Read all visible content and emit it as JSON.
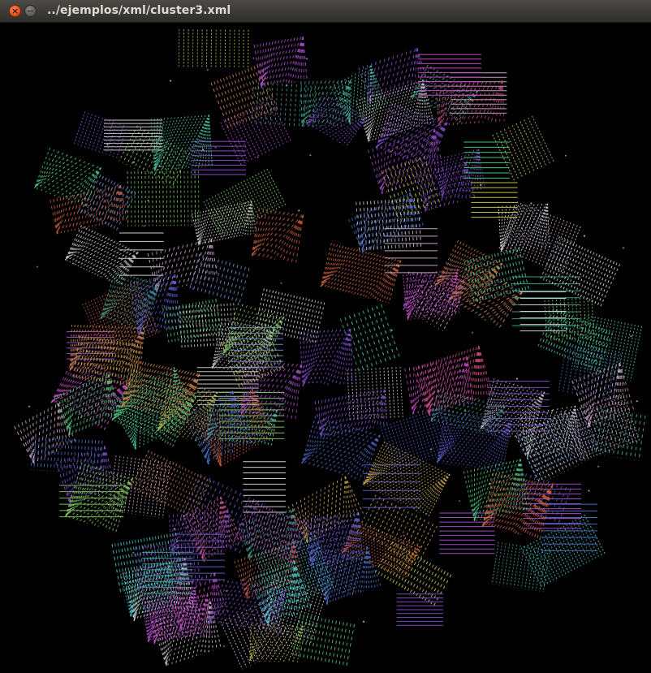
{
  "window": {
    "title": "../ejemplos/xml/cluster3.xml",
    "close_glyph": "×",
    "minimize_glyph": "−"
  },
  "canvas": {
    "background": "#000000",
    "palette": [
      "#c2c24a",
      "#5a5acc",
      "#7ac25a",
      "#c25a3a",
      "#c24ac2",
      "#3ac2c2",
      "#8a4acc",
      "#c2a24a",
      "#4ac27a",
      "#c24a7a",
      "#6a8acc",
      "#cccccc",
      "#7a4ac2",
      "#4a6ac2",
      "#c2c2c2",
      "#3a9a8a",
      "#c27a4a",
      "#a24ac2",
      "#4ac2a2",
      "#c2a2c2"
    ]
  }
}
